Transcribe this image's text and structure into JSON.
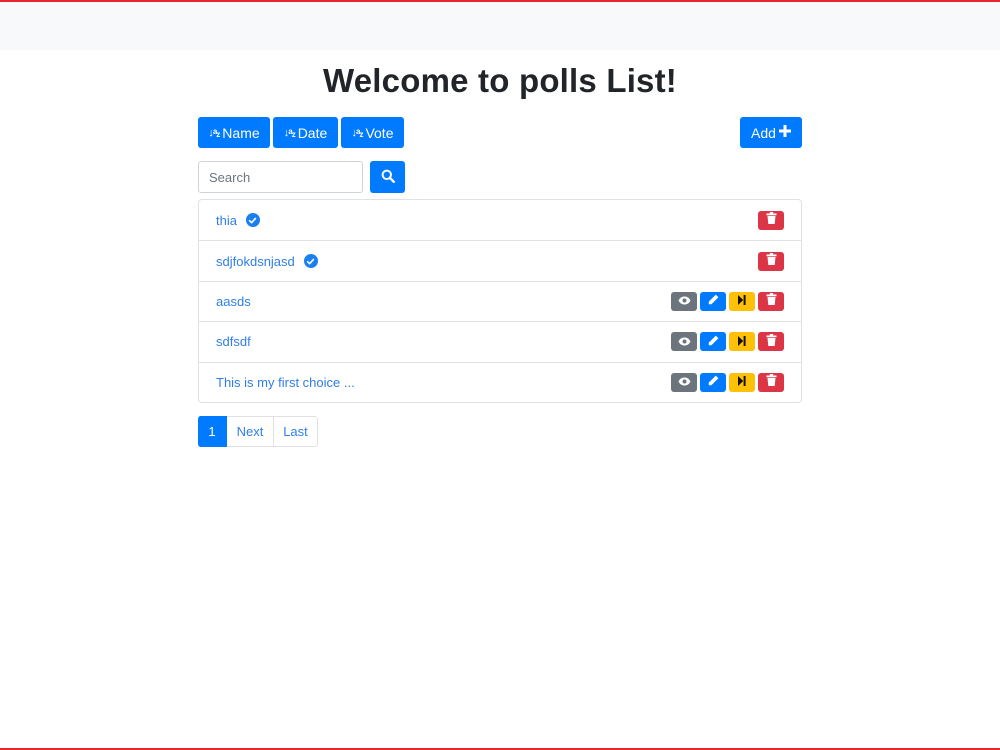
{
  "page": {
    "title": "Welcome to polls List!"
  },
  "toolbar": {
    "sort_icon": "↓a↓z",
    "sort_buttons": [
      "Name",
      "Date",
      "Vote"
    ],
    "add_label": "Add"
  },
  "search": {
    "placeholder": "Search",
    "value": ""
  },
  "polls": [
    {
      "title": "thia",
      "verified": true,
      "actions": [
        "delete"
      ]
    },
    {
      "title": "sdjfokdsnjasd",
      "verified": true,
      "actions": [
        "delete"
      ]
    },
    {
      "title": "aasds",
      "verified": false,
      "actions": [
        "view",
        "edit",
        "next",
        "delete"
      ]
    },
    {
      "title": "sdfsdf",
      "verified": false,
      "actions": [
        "view",
        "edit",
        "next",
        "delete"
      ]
    },
    {
      "title": "This is my first choice ...",
      "verified": false,
      "actions": [
        "view",
        "edit",
        "next",
        "delete"
      ]
    }
  ],
  "pagination": {
    "current": "1",
    "next_label": "Next",
    "last_label": "Last"
  },
  "icons": {
    "sort": "sort-alpha-down-icon",
    "add": "plus-icon",
    "search": "search-icon",
    "verified": "check-circle-icon",
    "view": "eye-icon",
    "edit": "pencil-icon",
    "next": "step-forward-icon",
    "delete": "trash-icon"
  },
  "colors": {
    "primary": "#007bff",
    "secondary": "#6c757d",
    "warning": "#ffc107",
    "danger": "#dc3545",
    "link": "#2f7fe8",
    "frame": "#e8262c"
  }
}
